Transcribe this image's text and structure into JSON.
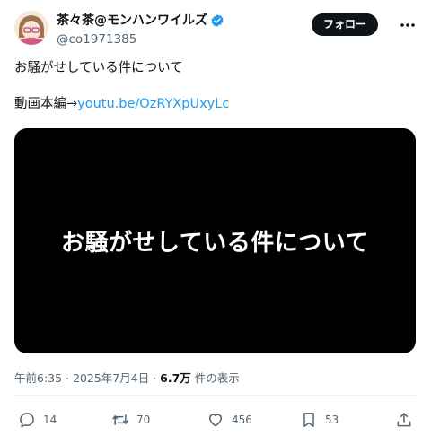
{
  "author": {
    "display_name": "茶々茶@モンハンワイルズ",
    "handle": "@co1971385",
    "verified": true
  },
  "follow_label": "フォロー",
  "tweet": {
    "line1": "お騒がせしている件について",
    "line2_prefix": "動画本編→",
    "link_text": "youtu.be/OzRYXpUxyLc"
  },
  "media": {
    "title_text": "お騒がせしている件について"
  },
  "meta": {
    "time": "午前6:35",
    "sep1": " · ",
    "date": "2025年7月4日",
    "sep2": " · ",
    "views_count": "6.7万",
    "views_suffix": " 件の表示"
  },
  "actions": {
    "replies": "14",
    "reposts": "70",
    "likes": "456",
    "bookmarks": "53"
  },
  "colors": {
    "link": "#1d9bf0",
    "verified": "#1d9bf0",
    "muted": "#536471",
    "text": "#0f1419"
  }
}
